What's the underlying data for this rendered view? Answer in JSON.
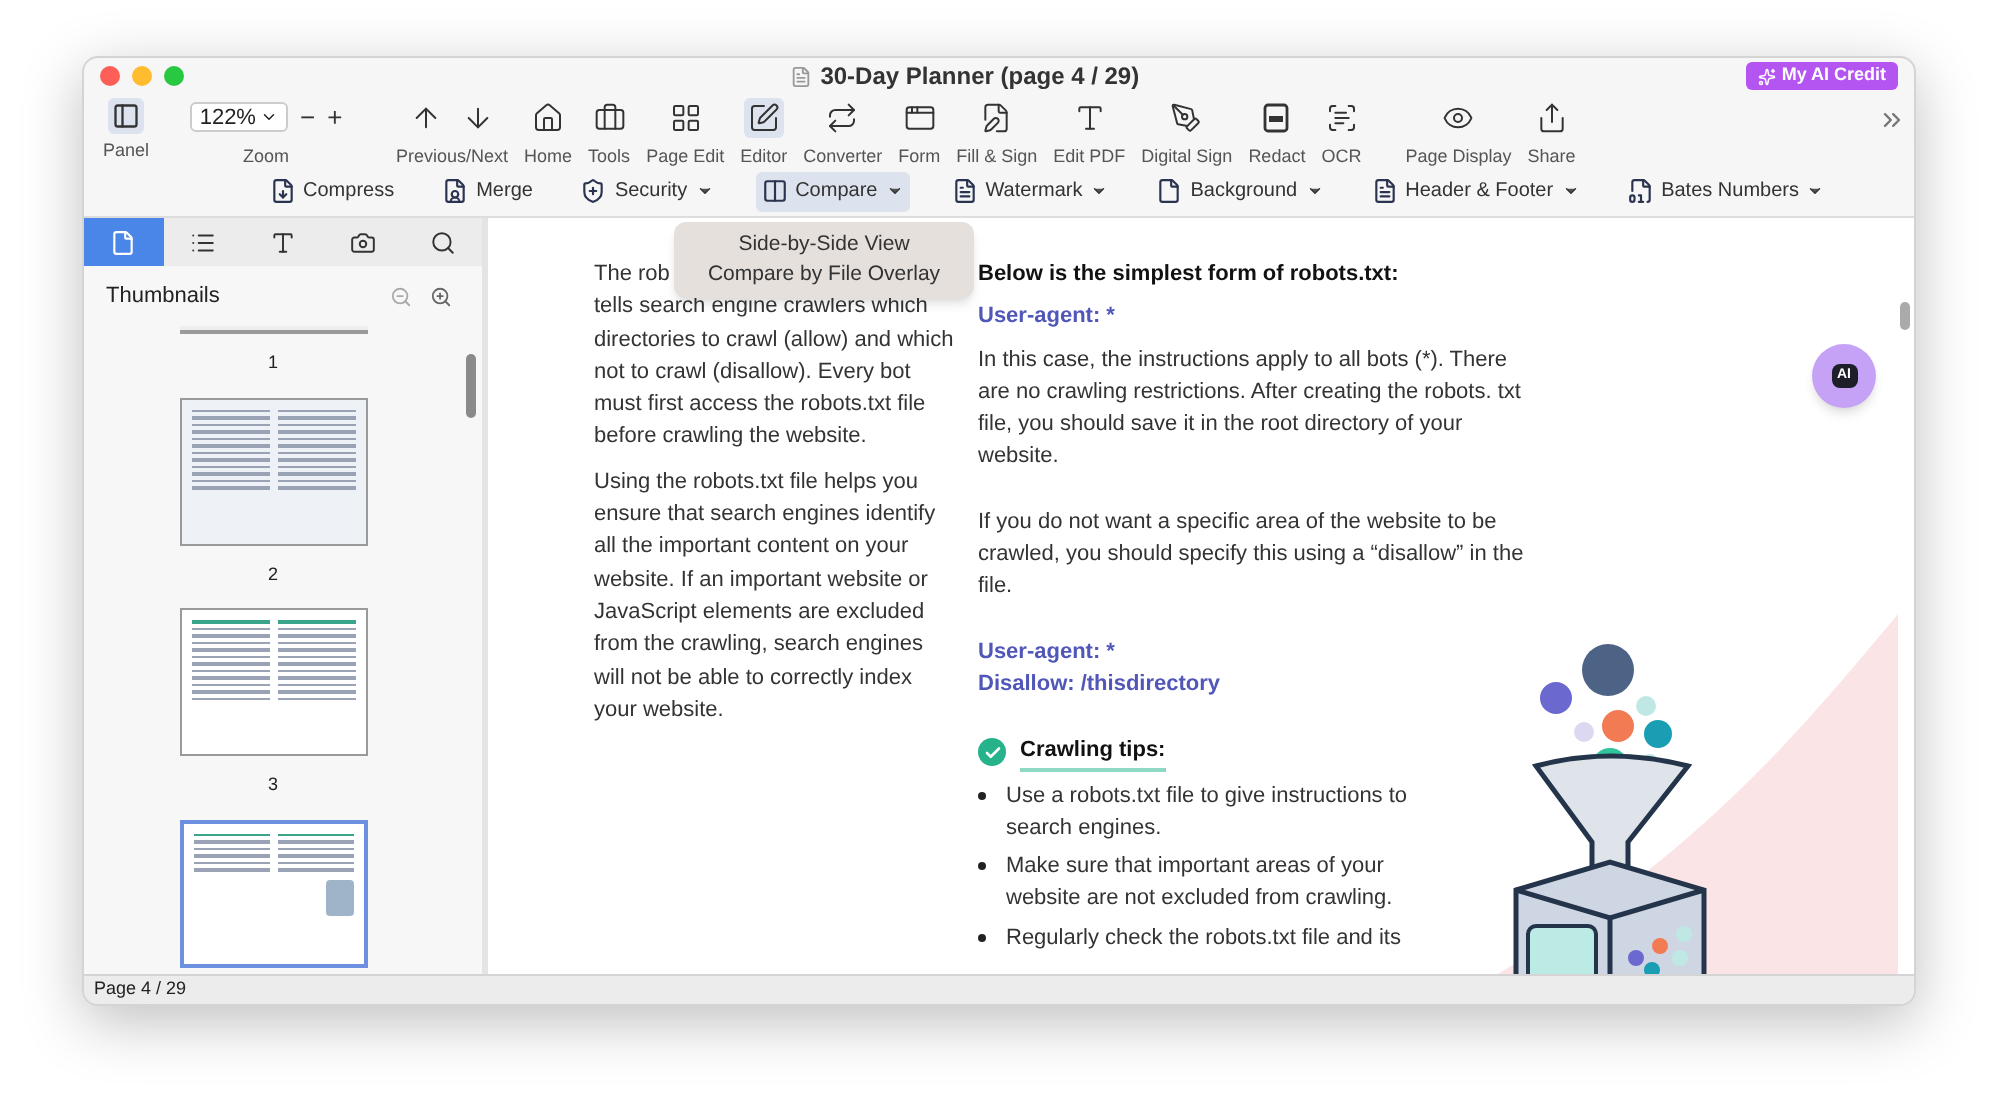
{
  "window": {
    "title": "30-Day Planner (page 4 / 29)",
    "ai_credit": "My AI Credit"
  },
  "toolbar": {
    "panel": "Panel",
    "zoom": {
      "value": "122%",
      "label": "Zoom",
      "minus": "−",
      "plus": "+"
    },
    "items": [
      {
        "kind": "prevnext",
        "label": "Previous/Next",
        "selected": false
      },
      {
        "kind": "home",
        "label": "Home",
        "selected": false
      },
      {
        "kind": "tools",
        "label": "Tools",
        "selected": false
      },
      {
        "kind": "pageedit",
        "label": "Page Edit",
        "selected": false
      },
      {
        "kind": "editor",
        "label": "Editor",
        "selected": true
      },
      {
        "kind": "converter",
        "label": "Converter",
        "selected": false
      },
      {
        "kind": "form",
        "label": "Form",
        "selected": false
      },
      {
        "kind": "fillsign",
        "label": "Fill & Sign",
        "selected": false
      },
      {
        "kind": "editpdf",
        "label": "Edit PDF",
        "selected": false
      },
      {
        "kind": "digitalsign",
        "label": "Digital Sign",
        "selected": false
      },
      {
        "kind": "redact",
        "label": "Redact",
        "selected": false
      },
      {
        "kind": "ocr",
        "label": "OCR",
        "selected": false
      },
      {
        "kind": "pagedisplay",
        "label": "Page Display",
        "selected": false
      },
      {
        "kind": "share",
        "label": "Share",
        "selected": false
      }
    ]
  },
  "subtoolbar": [
    {
      "kind": "compress",
      "label": "Compress",
      "dropdown": false,
      "selected": false
    },
    {
      "kind": "merge",
      "label": "Merge",
      "dropdown": false,
      "selected": false
    },
    {
      "kind": "security",
      "label": "Security",
      "dropdown": true,
      "selected": false
    },
    {
      "kind": "compare",
      "label": "Compare",
      "dropdown": true,
      "selected": true
    },
    {
      "kind": "watermark",
      "label": "Watermark",
      "dropdown": true,
      "selected": false
    },
    {
      "kind": "background",
      "label": "Background",
      "dropdown": true,
      "selected": false
    },
    {
      "kind": "headerfooter",
      "label": "Header & Footer",
      "dropdown": true,
      "selected": false
    },
    {
      "kind": "bates",
      "label": "Bates Numbers",
      "dropdown": true,
      "selected": false
    }
  ],
  "compare_menu": [
    "Side-by-Side View",
    "Compare by File Overlay"
  ],
  "sidebar": {
    "tabs": [
      {
        "kind": "pages",
        "selected": true
      },
      {
        "kind": "outline",
        "selected": false
      },
      {
        "kind": "text",
        "selected": false
      },
      {
        "kind": "snapshot",
        "selected": false
      },
      {
        "kind": "search",
        "selected": false
      }
    ],
    "title": "Thumbnails",
    "thumbnails": [
      {
        "label": "1",
        "kind": "cut",
        "selected": false
      },
      {
        "label": "2",
        "kind": "contents",
        "selected": false
      },
      {
        "label": "3",
        "kind": "text",
        "selected": false
      },
      {
        "kind": "illustrated",
        "selected": true
      }
    ]
  },
  "document": {
    "left": [
      "The rob",
      "tells search engine crawlers which directories to crawl (allow) and which not to crawl (disallow). Every bot must first access the robots.txt file before crawling the website.",
      "Using the robots.txt file helps you ensure that search engines identify all the important content on your website. If an important website or JavaScript elements are excluded from the crawling, search engines will not be able to correctly index your website."
    ],
    "right": [
      {
        "kind": "heading",
        "text": "Below is the simplest form of robots.txt:"
      },
      {
        "kind": "code",
        "text": "User-agent: *"
      },
      {
        "kind": "para",
        "text": "In this case, the instructions apply to all bots (*). There are no crawling restrictions. After creating the robots. txt file, you should save it in the root directory of your website."
      },
      {
        "kind": "para",
        "text": "If you do not want a specific area of the website to be crawled, you should specify this using a “disallow” in the file."
      },
      {
        "kind": "code",
        "text": "User-agent: *"
      },
      {
        "kind": "code",
        "text": "Disallow: /thisdirectory"
      }
    ],
    "tips_title": "Crawling tips:",
    "tips": [
      "Use a robots.txt file to give instructions to search engines.",
      "Make sure that important areas of your website are not excluded from crawling.",
      "Regularly check the robots.txt file and its"
    ],
    "ai_button": "AI"
  },
  "status_bar": "Page 4 / 29"
}
